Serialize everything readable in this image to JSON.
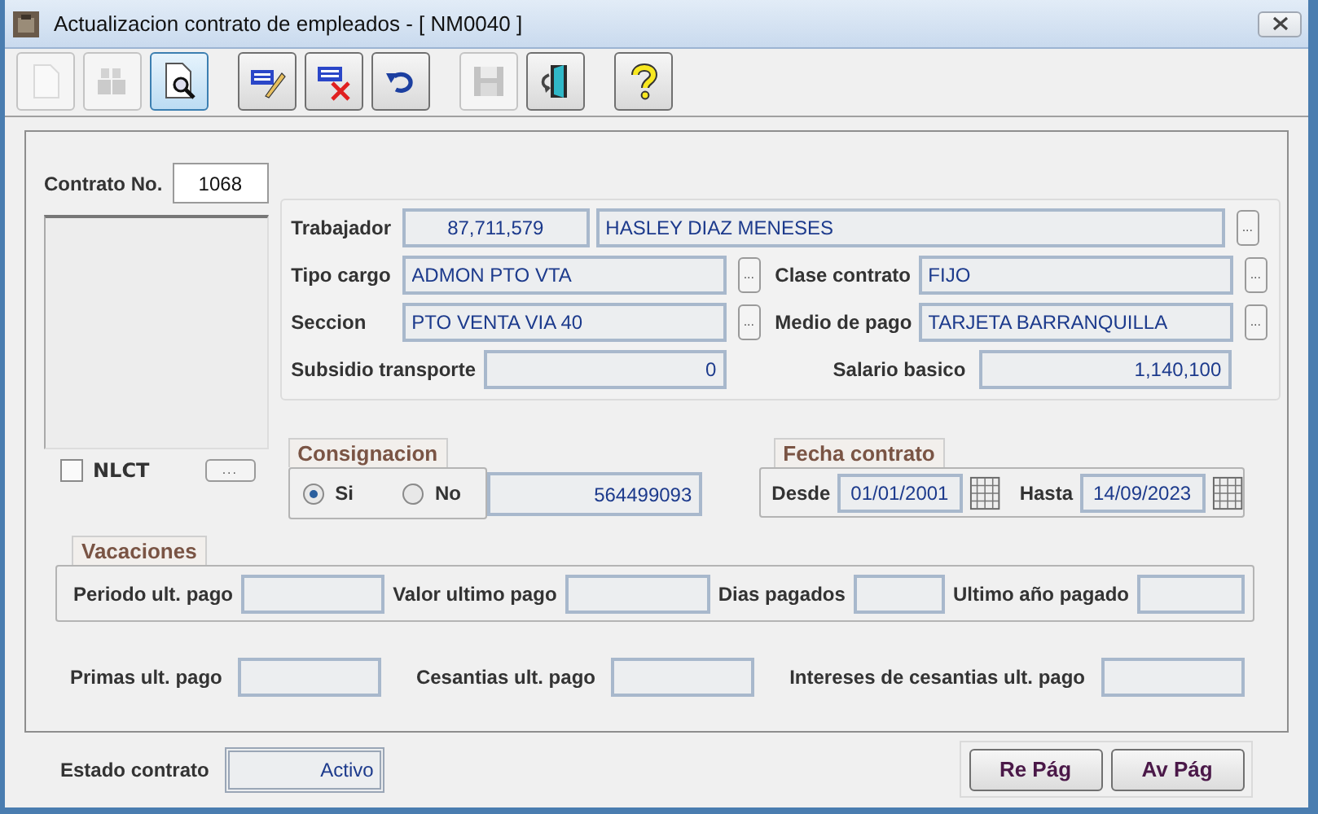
{
  "window": {
    "title": "Actualizacion contrato de empleados - [ NM0040 ]"
  },
  "toolbar": [
    [
      {
        "kind": "new",
        "disabled": true,
        "selected": false
      },
      {
        "kind": "find",
        "disabled": true,
        "selected": false
      },
      {
        "kind": "preview",
        "disabled": false,
        "selected": true
      }
    ],
    [
      {
        "kind": "edit",
        "disabled": false,
        "selected": false
      },
      {
        "kind": "delete",
        "disabled": false,
        "selected": false
      },
      {
        "kind": "undo",
        "disabled": false,
        "selected": false
      }
    ],
    [
      {
        "kind": "save",
        "disabled": true,
        "selected": false
      },
      {
        "kind": "exit",
        "disabled": false,
        "selected": false
      }
    ],
    [
      {
        "kind": "help",
        "disabled": false,
        "selected": false
      }
    ]
  ],
  "contract_no": {
    "label": "Contrato No.",
    "value": "1068"
  },
  "nlct": {
    "label": "NLCT",
    "checked": false,
    "button": "..."
  },
  "details": {
    "worker": {
      "label": "Trabajador",
      "id": "87,711,579",
      "name": "HASLEY DIAZ MENESES",
      "button": "..."
    },
    "rows": [
      {
        "left": {
          "label": "Tipo cargo",
          "value": "ADMON PTO VTA",
          "button": "..."
        },
        "right": {
          "label": "Clase contrato",
          "value": "FIJO",
          "button": "..."
        }
      },
      {
        "left": {
          "label": "Seccion",
          "value": "PTO VENTA VIA 40",
          "button": "..."
        },
        "right": {
          "label": "Medio de pago",
          "value": "TARJETA BARRANQUILLA",
          "button": "..."
        }
      }
    ],
    "transport": {
      "label": "Subsidio transporte",
      "value": "0"
    },
    "salary": {
      "label": "Salario basico",
      "value": "1,140,100"
    }
  },
  "consignacion": {
    "title": "Consignacion",
    "options": [
      {
        "label": "Si",
        "selected": true
      },
      {
        "label": "No",
        "selected": false
      }
    ],
    "account": "564499093"
  },
  "fecha_contrato": {
    "title": "Fecha contrato",
    "from": {
      "label": "Desde",
      "value": "01/01/2001"
    },
    "to": {
      "label": "Hasta",
      "value": "14/09/2023"
    }
  },
  "vacaciones": {
    "title": "Vacaciones",
    "fields": [
      {
        "label": "Periodo ult. pago"
      },
      {
        "label": "Valor ultimo pago"
      },
      {
        "label": "Dias pagados"
      },
      {
        "label": "Ultimo año pagado"
      }
    ]
  },
  "payments": [
    {
      "label": "Primas ult. pago"
    },
    {
      "label": "Cesantias ult. pago"
    },
    {
      "label": "Intereses de cesantias ult. pago"
    }
  ],
  "status": {
    "label": "Estado contrato",
    "value": "Activo"
  },
  "buttons": [
    "Re Pág",
    "Av Pág"
  ]
}
